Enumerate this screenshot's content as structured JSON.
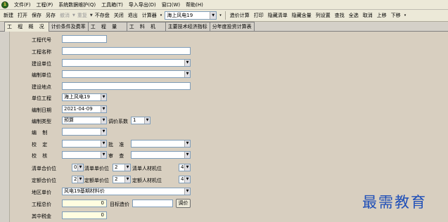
{
  "app": {
    "menu": [
      "文件(F)",
      "工程(P)",
      "系统数据维护(Q)",
      "工具箱(T)",
      "导入导出(D)",
      "窗口(W)",
      "帮助(H)"
    ]
  },
  "toolbar": {
    "new": "新建",
    "open": "打开",
    "save": "保存",
    "save_as": "另存",
    "undo": "撤消",
    "redo": "重复",
    "no_save": "不存盘",
    "close": "关闭",
    "exit": "退出",
    "calculator": "计算器",
    "project_combo": "海上风电19",
    "adjust_calc": "造价计算",
    "print": "打印",
    "hide_list": "隐藏清单",
    "hide_content": "隐藏含量",
    "column_settings": "列设置",
    "find": "查找",
    "select_all": "全选",
    "cancel": "取消",
    "move_up": "上移",
    "move_down": "下移"
  },
  "tabs": [
    {
      "label": "工 程 概 况",
      "active": true
    },
    {
      "label": "计价条件及费率",
      "active": false
    },
    {
      "label": "工 程 量",
      "active": false
    },
    {
      "label": "工 料 机",
      "active": false
    },
    {
      "label": "主要技术经济指标",
      "active": false
    },
    {
      "label": "分年度投资计算表",
      "active": false
    }
  ],
  "form": {
    "project_code": {
      "label": "工程代号",
      "value": ""
    },
    "project_name": {
      "label": "工程名称",
      "value": ""
    },
    "builder": {
      "label": "建设单位",
      "value": ""
    },
    "compiler": {
      "label": "编制单位",
      "value": ""
    },
    "location": {
      "label": "建设地点",
      "value": ""
    },
    "unit_project": {
      "label": "单位工程",
      "value": "海上风电19"
    },
    "date": {
      "label": "编制日期",
      "value": "2021-04-09"
    },
    "type": {
      "label": "编制类型",
      "value": "预算"
    },
    "adjust_coef": {
      "label": "调价系数",
      "value": "1"
    },
    "editor": {
      "label": "编 制",
      "value": ""
    },
    "checker": {
      "label": "校 定",
      "value": ""
    },
    "approver": {
      "label": "批 准",
      "value": ""
    },
    "reviewer": {
      "label": "校 核",
      "value": ""
    },
    "auditor": {
      "label": "审 查",
      "value": ""
    },
    "list_total_decimals": {
      "label": "清单合价位",
      "value": "0"
    },
    "list_unit_decimals": {
      "label": "清单单价位",
      "value": "2"
    },
    "list_material_decimals": {
      "label": "清单人材机位",
      "value": "4"
    },
    "quota_total_decimals": {
      "label": "定额合价位",
      "value": "2"
    },
    "quota_unit_decimals": {
      "label": "定额单价位",
      "value": "2"
    },
    "quota_material_decimals": {
      "label": "定额人材机位",
      "value": "4"
    },
    "region_price": {
      "label": "地区单价",
      "value": "风电19基期材料价"
    },
    "total_cost": {
      "label": "工程总价",
      "value": "0"
    },
    "target_price": {
      "label": "目标造价",
      "value": ""
    },
    "adjust_button": "调价",
    "tax": {
      "label": "其中税金",
      "value": "0"
    }
  },
  "watermark": "最需教育"
}
